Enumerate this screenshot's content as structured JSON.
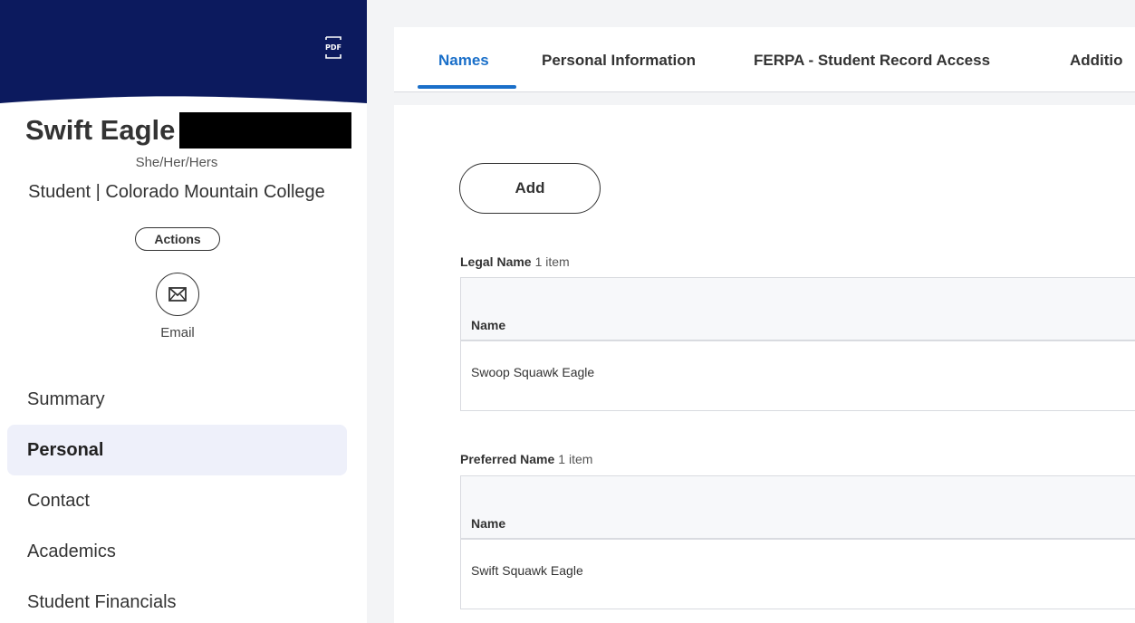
{
  "profile": {
    "name": "Swift Eagle",
    "pronouns": "She/Her/Hers",
    "subtitle": "Student | Colorado Mountain College",
    "actions_label": "Actions",
    "email_label": "Email",
    "banner_color": "#0c1a5e"
  },
  "nav": {
    "items": [
      {
        "label": "Summary",
        "active": false
      },
      {
        "label": "Personal",
        "active": true
      },
      {
        "label": "Contact",
        "active": false
      },
      {
        "label": "Academics",
        "active": false
      },
      {
        "label": "Student Financials",
        "active": false
      }
    ]
  },
  "tabs": [
    {
      "label": "Names",
      "active": true
    },
    {
      "label": "Personal Information",
      "active": false
    },
    {
      "label": "FERPA - Student Record Access",
      "active": false
    },
    {
      "label": "Additio",
      "active": false
    }
  ],
  "main": {
    "add_label": "Add",
    "sections": [
      {
        "title": "Legal Name",
        "count": "1 item",
        "column": "Name",
        "value": "Swoop Squawk Eagle"
      },
      {
        "title": "Preferred Name",
        "count": "1 item",
        "column": "Name",
        "value": "Swift Squawk Eagle"
      }
    ]
  },
  "colors": {
    "accent": "#1a6fc9",
    "active_nav_bg": "#eef0fa"
  }
}
